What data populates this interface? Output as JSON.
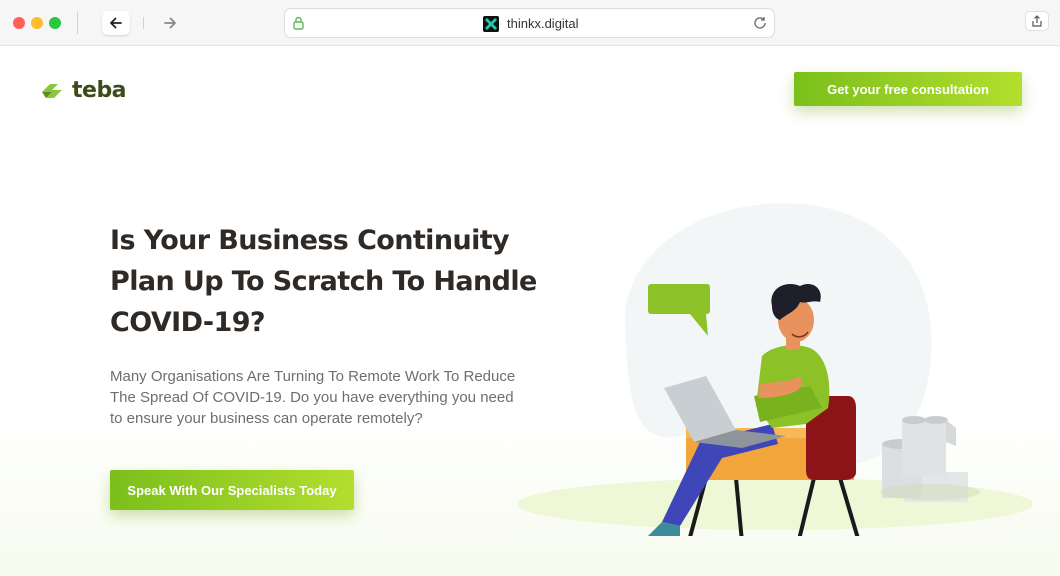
{
  "browser": {
    "url": "thinkx.digital",
    "traffic_lights": [
      "close",
      "minimize",
      "zoom"
    ]
  },
  "colors": {
    "accent_start": "#7bbf1c",
    "accent_end": "#b3de2e",
    "headline": "#2f2a26",
    "body_text": "#6e6e6e"
  },
  "header": {
    "logo_text": "teba",
    "cta_label": "Get your free consultation"
  },
  "hero": {
    "headline": "Is Your Business Continuity Plan Up To Scratch To Handle COVID-19?",
    "subtext": "Many Organisations Are Turning To Remote Work To Reduce The Spread Of COVID-19. Do you have everything you need to ensure your business can operate remotely?",
    "cta_label": "Speak With Our Specialists Today"
  },
  "illustration": {
    "description_icon": "remote-worker-illustration"
  }
}
